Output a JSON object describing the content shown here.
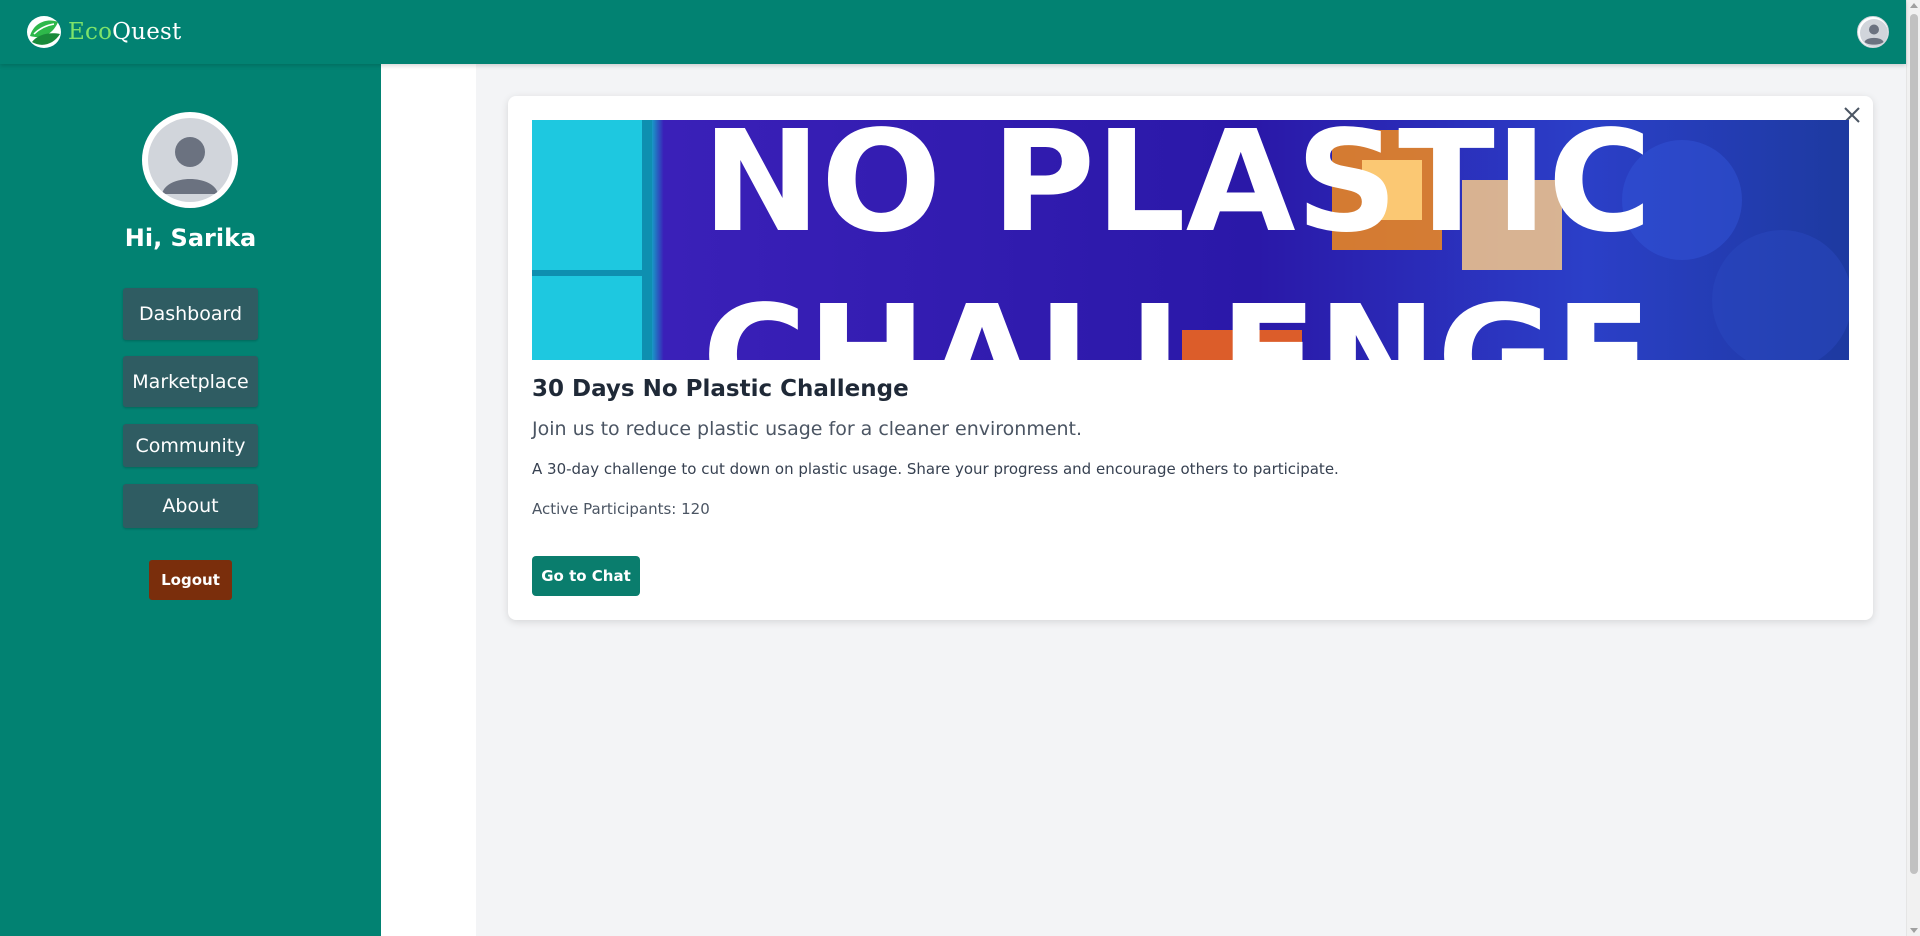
{
  "app": {
    "logo_part1": "Eco",
    "logo_part2": "Quest",
    "logo_icon": "leaf-globe-icon",
    "user_icon": "user-avatar-icon"
  },
  "colors": {
    "header_bg": "#028272",
    "sidebar_bg": "#028272",
    "nav_button_bg": "#2f5c62",
    "logout_bg": "#7a2e0c",
    "primary_button_bg": "#0a7d6d",
    "logo_accent": "#7ee36a"
  },
  "sidebar": {
    "greeting": "Hi, Sarika",
    "nav_items": [
      {
        "label": "Dashboard"
      },
      {
        "label": "Marketplace"
      },
      {
        "label": "Community"
      },
      {
        "label": "About"
      }
    ],
    "logout_label": "Logout"
  },
  "challenge": {
    "banner_text_line1": "NO PLASTIC",
    "banner_text_line2": "CHALLENGE",
    "title": "30 Days No Plastic Challenge",
    "subtitle": "Join us to reduce plastic usage for a cleaner environment.",
    "description": "A 30-day challenge to cut down on plastic usage. Share your progress and encourage others to participate.",
    "participants_label": "Active Participants:",
    "participants_count": "120",
    "chat_button_label": "Go to Chat",
    "close_icon": "close-icon"
  }
}
